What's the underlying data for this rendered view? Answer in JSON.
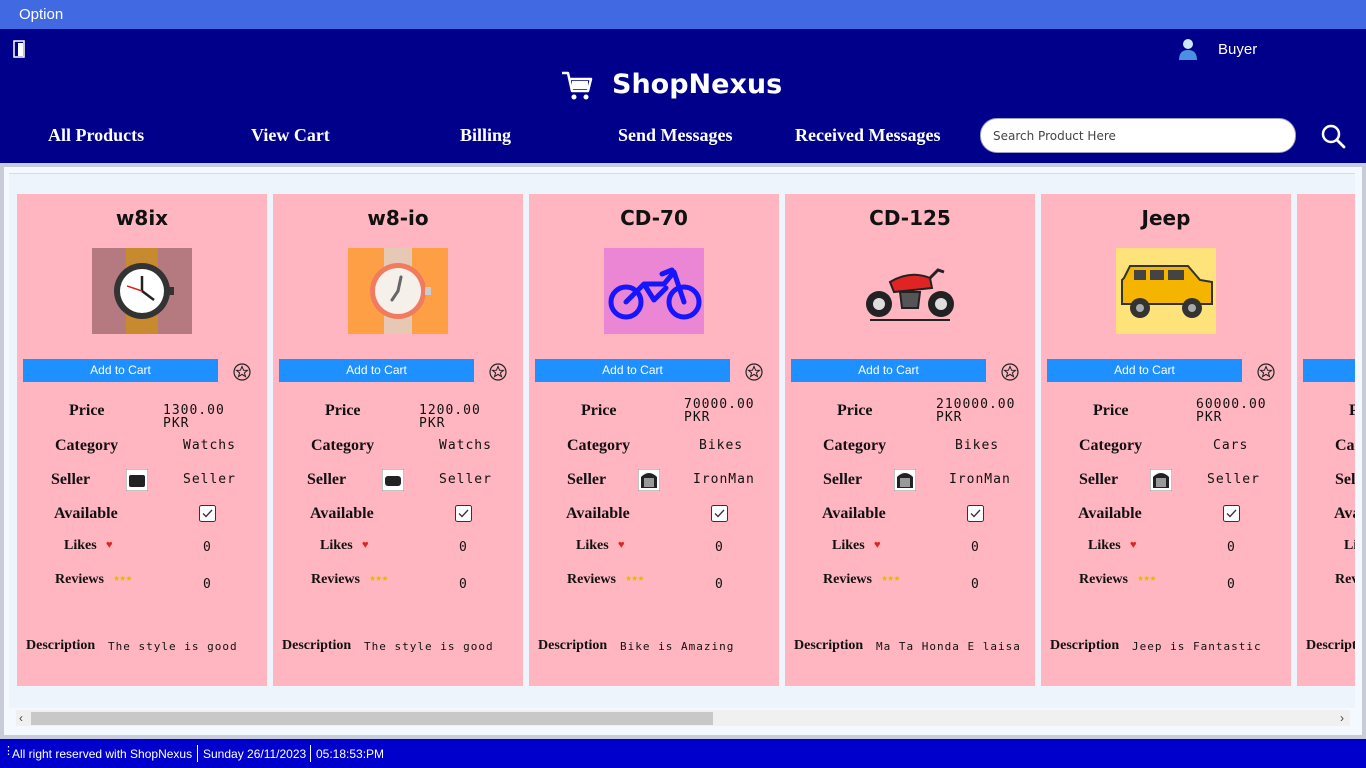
{
  "menu": {
    "option_label": "Option"
  },
  "header": {
    "role": "Buyer",
    "brand": "ShopNexus"
  },
  "nav": {
    "all_products": "All Products",
    "view_cart": "View Cart",
    "billing": "Billing",
    "send_messages": "Send Messages",
    "received_messages": "Received Messages"
  },
  "search": {
    "placeholder": "Search Product Here"
  },
  "labels": {
    "add_to_cart": "Add to Cart",
    "price": "Price",
    "category": "Category",
    "seller": "Seller",
    "available": "Available",
    "likes": "Likes",
    "reviews": "Reviews",
    "description": "Description"
  },
  "products": [
    {
      "name": "w8ix",
      "price": "1300.00 PKR",
      "category": "Watchs",
      "seller": "Seller",
      "likes": "0",
      "reviews": "0",
      "description": "The style is good",
      "available": true,
      "image": "watch-dark-icon"
    },
    {
      "name": "w8-io",
      "price": "1200.00 PKR",
      "category": "Watchs",
      "seller": "Seller",
      "likes": "0",
      "reviews": "0",
      "description": "The style is good",
      "available": true,
      "image": "watch-light-icon"
    },
    {
      "name": "CD-70",
      "price": "70000.00 PKR",
      "category": "Bikes",
      "seller": "IronMan",
      "likes": "0",
      "reviews": "0",
      "description": "Bike is Amazing",
      "available": true,
      "image": "dirt-bike-icon"
    },
    {
      "name": "CD-125",
      "price": "210000.00 PKR",
      "category": "Bikes",
      "seller": "IronMan",
      "likes": "0",
      "reviews": "0",
      "description": "Ma Ta Honda E laisa",
      "available": true,
      "image": "motorcycle-icon"
    },
    {
      "name": "Jeep",
      "price": "60000.00 PKR",
      "category": "Cars",
      "seller": "Seller",
      "likes": "0",
      "reviews": "0",
      "description": "Jeep is Fantastic",
      "available": true,
      "image": "jeep-icon"
    }
  ],
  "status": {
    "rights": "All right reserved with ShopNexus",
    "date": "Sunday 26/11/2023",
    "time": "05:18:53:PM"
  },
  "colors": {
    "menu": "#4169e1",
    "header": "#00008b",
    "card": "#ffb6c1",
    "button": "#1e90ff",
    "status": "#0000cd"
  }
}
